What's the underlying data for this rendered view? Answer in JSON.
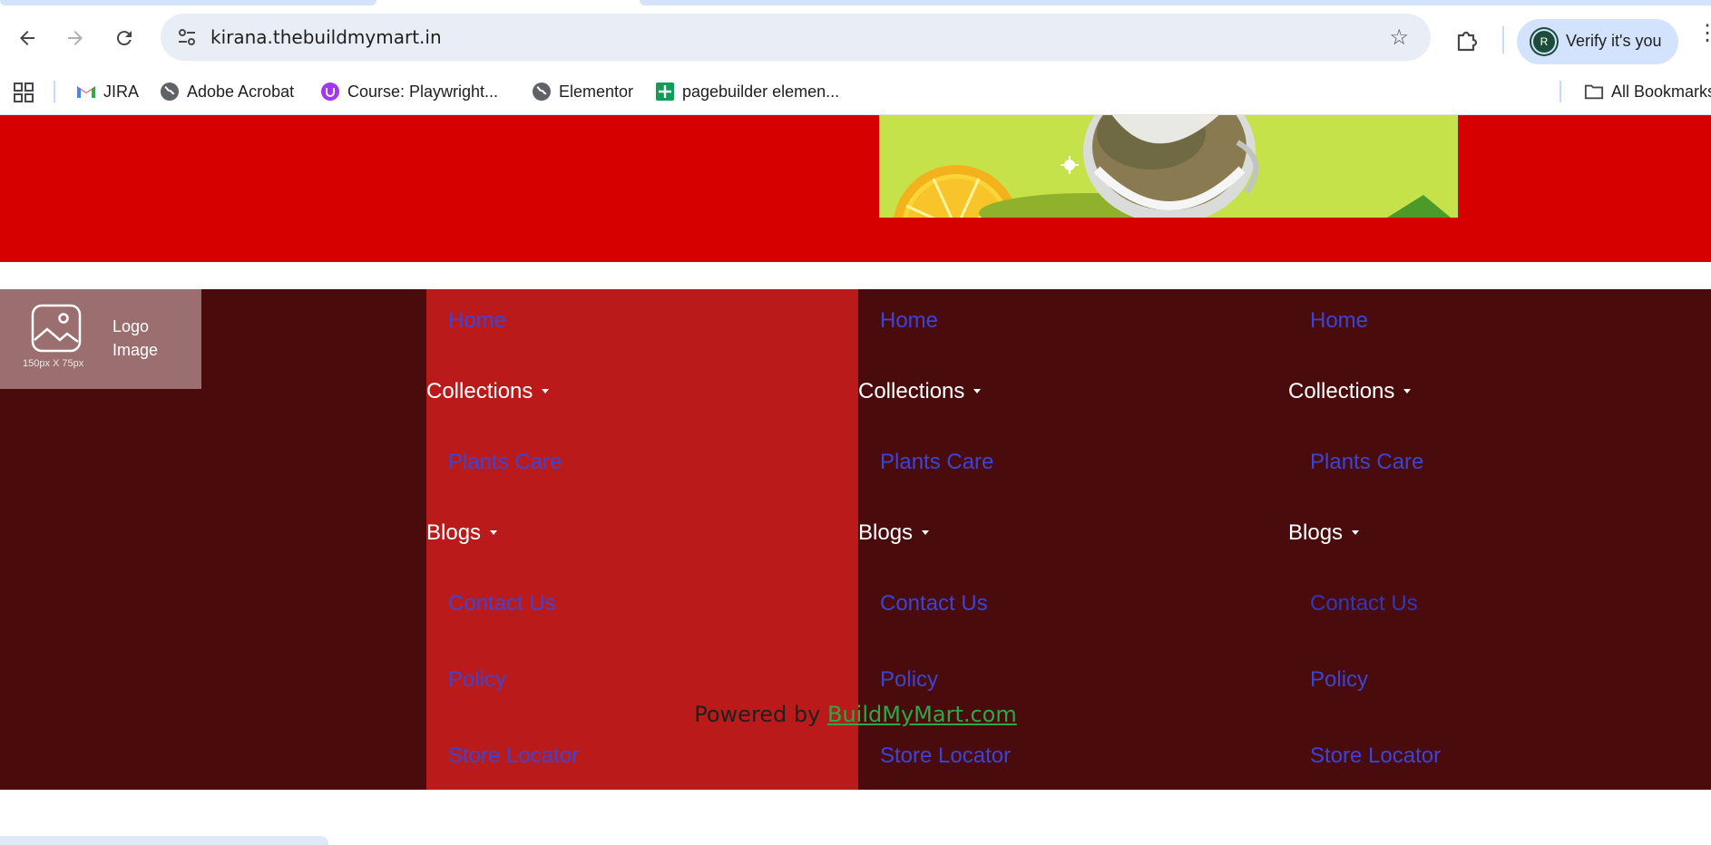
{
  "browser": {
    "url": "kirana.thebuildmymart.in",
    "profile_label": "Verify it's you",
    "profile_initial": "R",
    "bookmarks": [
      {
        "label": "JIRA",
        "icon": "gmail-icon"
      },
      {
        "label": "Adobe Acrobat",
        "icon": "globe-icon"
      },
      {
        "label": "Course: Playwright...",
        "icon": "udemy-icon"
      },
      {
        "label": "Elementor",
        "icon": "globe-icon"
      },
      {
        "label": "pagebuilder elemen...",
        "icon": "sheets-icon"
      }
    ],
    "all_bookmarks_label": "All Bookmarks"
  },
  "footer": {
    "logo": {
      "text": "Logo Image",
      "size_hint": "150px X 75px"
    },
    "columns": [
      {
        "items": [
          {
            "label": "Home",
            "type": "link"
          },
          {
            "label": "Collections",
            "type": "parent"
          },
          {
            "label": "Plants Care",
            "type": "link"
          },
          {
            "label": "Blogs",
            "type": "parent"
          },
          {
            "label": "Contact Us",
            "type": "link"
          },
          {
            "label": "Policy",
            "type": "link"
          },
          {
            "label": "Store Locator",
            "type": "link"
          }
        ]
      },
      {
        "items": [
          {
            "label": "Home",
            "type": "link"
          },
          {
            "label": "Collections",
            "type": "parent"
          },
          {
            "label": "Plants Care",
            "type": "link"
          },
          {
            "label": "Blogs",
            "type": "parent"
          },
          {
            "label": "Contact Us",
            "type": "link"
          },
          {
            "label": "Policy",
            "type": "link"
          },
          {
            "label": "Store Locator",
            "type": "link"
          }
        ]
      },
      {
        "items": [
          {
            "label": "Home",
            "type": "link"
          },
          {
            "label": "Collections",
            "type": "parent"
          },
          {
            "label": "Plants Care",
            "type": "link"
          },
          {
            "label": "Blogs",
            "type": "parent"
          },
          {
            "label": "Contact Us",
            "type": "link"
          },
          {
            "label": "Policy",
            "type": "link"
          },
          {
            "label": "Store Locator",
            "type": "link"
          }
        ]
      }
    ],
    "powered_prefix": "Powered by",
    "powered_link": "BuildMyMart.com"
  },
  "colors": {
    "hero_red": "#d60000",
    "footer_dark": "#4a0b0c",
    "footer_col_red": "#bb1a1b",
    "link_blue": "#3a45d8",
    "powered_link_green": "#2ba84a"
  }
}
